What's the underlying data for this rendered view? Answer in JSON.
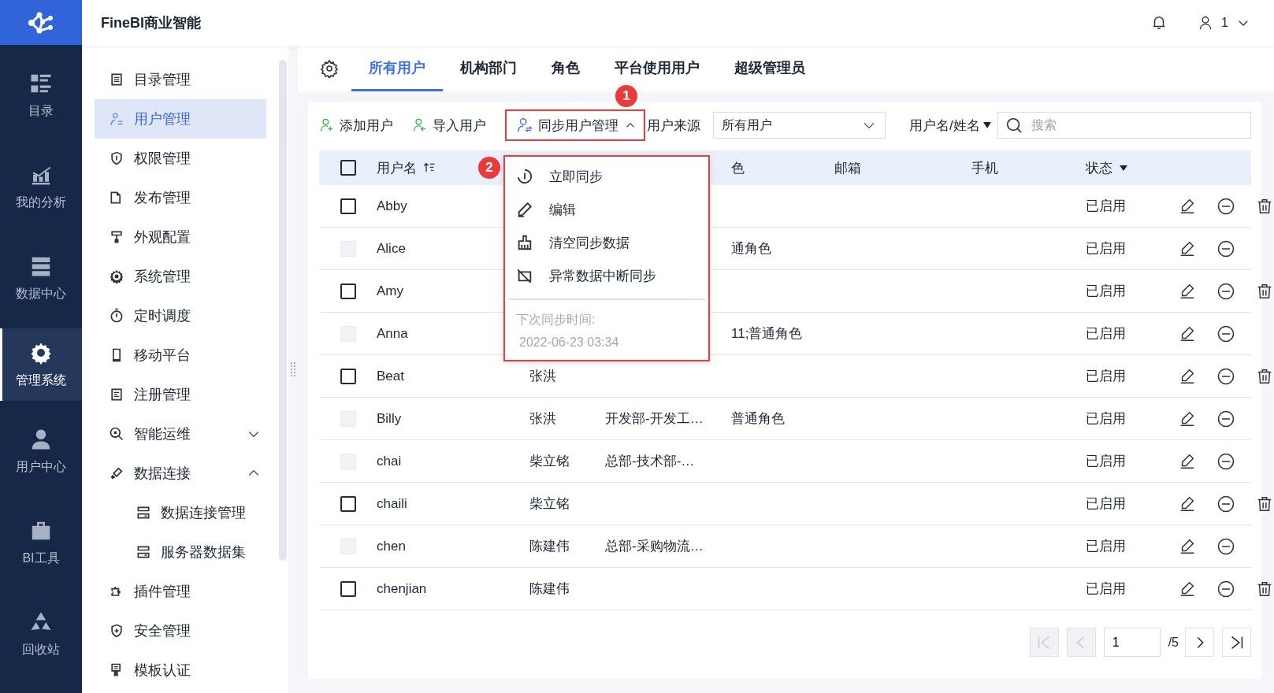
{
  "app": {
    "title": "FineBI商业智能",
    "user": "1"
  },
  "rail": [
    {
      "label": "目录",
      "selected": false
    },
    {
      "label": "我的分析",
      "selected": false
    },
    {
      "label": "数据中心",
      "selected": false
    },
    {
      "label": "管理系统",
      "selected": true
    },
    {
      "label": "用户中心",
      "selected": false
    },
    {
      "label": "BI工具",
      "selected": false
    },
    {
      "label": "回收站",
      "selected": false
    }
  ],
  "sidebar": {
    "items": [
      {
        "label": "目录管理",
        "selected": false
      },
      {
        "label": "用户管理",
        "selected": true
      },
      {
        "label": "权限管理",
        "selected": false
      },
      {
        "label": "发布管理",
        "selected": false
      },
      {
        "label": "外观配置",
        "selected": false
      },
      {
        "label": "系统管理",
        "selected": false
      },
      {
        "label": "定时调度",
        "selected": false
      },
      {
        "label": "移动平台",
        "selected": false
      },
      {
        "label": "注册管理",
        "selected": false
      },
      {
        "label": "智能运维",
        "selected": false,
        "expanded": false
      },
      {
        "label": "数据连接",
        "selected": false,
        "expanded": true,
        "children": [
          {
            "label": "数据连接管理",
            "selected": false
          },
          {
            "label": "服务器数据集",
            "selected": false
          }
        ]
      },
      {
        "label": "插件管理",
        "selected": false
      },
      {
        "label": "安全管理",
        "selected": false
      },
      {
        "label": "模板认证",
        "selected": false
      }
    ]
  },
  "tabs": [
    {
      "label": "所有用户",
      "selected": true
    },
    {
      "label": "机构部门",
      "selected": false
    },
    {
      "label": "角色",
      "selected": false
    },
    {
      "label": "平台使用用户",
      "selected": false
    },
    {
      "label": "超级管理员",
      "selected": false
    }
  ],
  "toolbar": {
    "buttons": [
      {
        "label": "添加用户"
      },
      {
        "label": "导入用户"
      }
    ],
    "sync_menu": {
      "label": "同步用户管理",
      "expanded": true,
      "callout": "1",
      "menu_callout": "2",
      "items": [
        {
          "label": "立即同步"
        },
        {
          "label": "编辑"
        },
        {
          "label": "清空同步数据"
        },
        {
          "label": "异常数据中断同步"
        }
      ],
      "next_sync_label": "下次同步时间:",
      "next_sync_time": "2022-06-23 03:34"
    },
    "source": {
      "label": "用户来源",
      "value": "所有用户"
    },
    "search_by": "用户名/姓名",
    "search": {
      "placeholder": "搜索"
    }
  },
  "table": {
    "header_checked": false,
    "columns": [
      {
        "label": "用户名"
      },
      {
        "label": "色"
      },
      {
        "label": "邮箱"
      },
      {
        "label": "手机"
      },
      {
        "label": "状态"
      }
    ],
    "rows": [
      {
        "name": "Abby",
        "status": "已启用",
        "checked": false,
        "disabled": false
      },
      {
        "name": "Alice",
        "role": "通角色",
        "status": "已启用",
        "checked": false,
        "disabled": true
      },
      {
        "name": "Amy",
        "status": "已启用",
        "checked": false,
        "disabled": false
      },
      {
        "name": "Anna",
        "role": "11;普通角色",
        "status": "已启用",
        "checked": false,
        "disabled": true
      },
      {
        "name": "Beat",
        "full_name": "张洪",
        "status": "已启用",
        "checked": false,
        "disabled": false
      },
      {
        "name": "Billy",
        "full_name": "张洪",
        "dept": "开发部-开发工…",
        "role": "普通角色",
        "status": "已启用",
        "checked": false,
        "disabled": true
      },
      {
        "name": "chai",
        "full_name": "柴立铭",
        "dept": "总部-技术部-…",
        "status": "已启用",
        "checked": false,
        "disabled": true
      },
      {
        "name": "chaili",
        "full_name": "柴立铭",
        "status": "已启用",
        "checked": false,
        "disabled": false
      },
      {
        "name": "chen",
        "full_name": "陈建伟",
        "dept": "总部-采购物流…",
        "status": "已启用",
        "checked": false,
        "disabled": true
      },
      {
        "name": "chenjian",
        "full_name": "陈建伟",
        "status": "已启用",
        "checked": false,
        "disabled": false
      }
    ]
  },
  "pager": {
    "page": "1",
    "total": "/5",
    "first_disabled": true,
    "prev_disabled": true
  }
}
